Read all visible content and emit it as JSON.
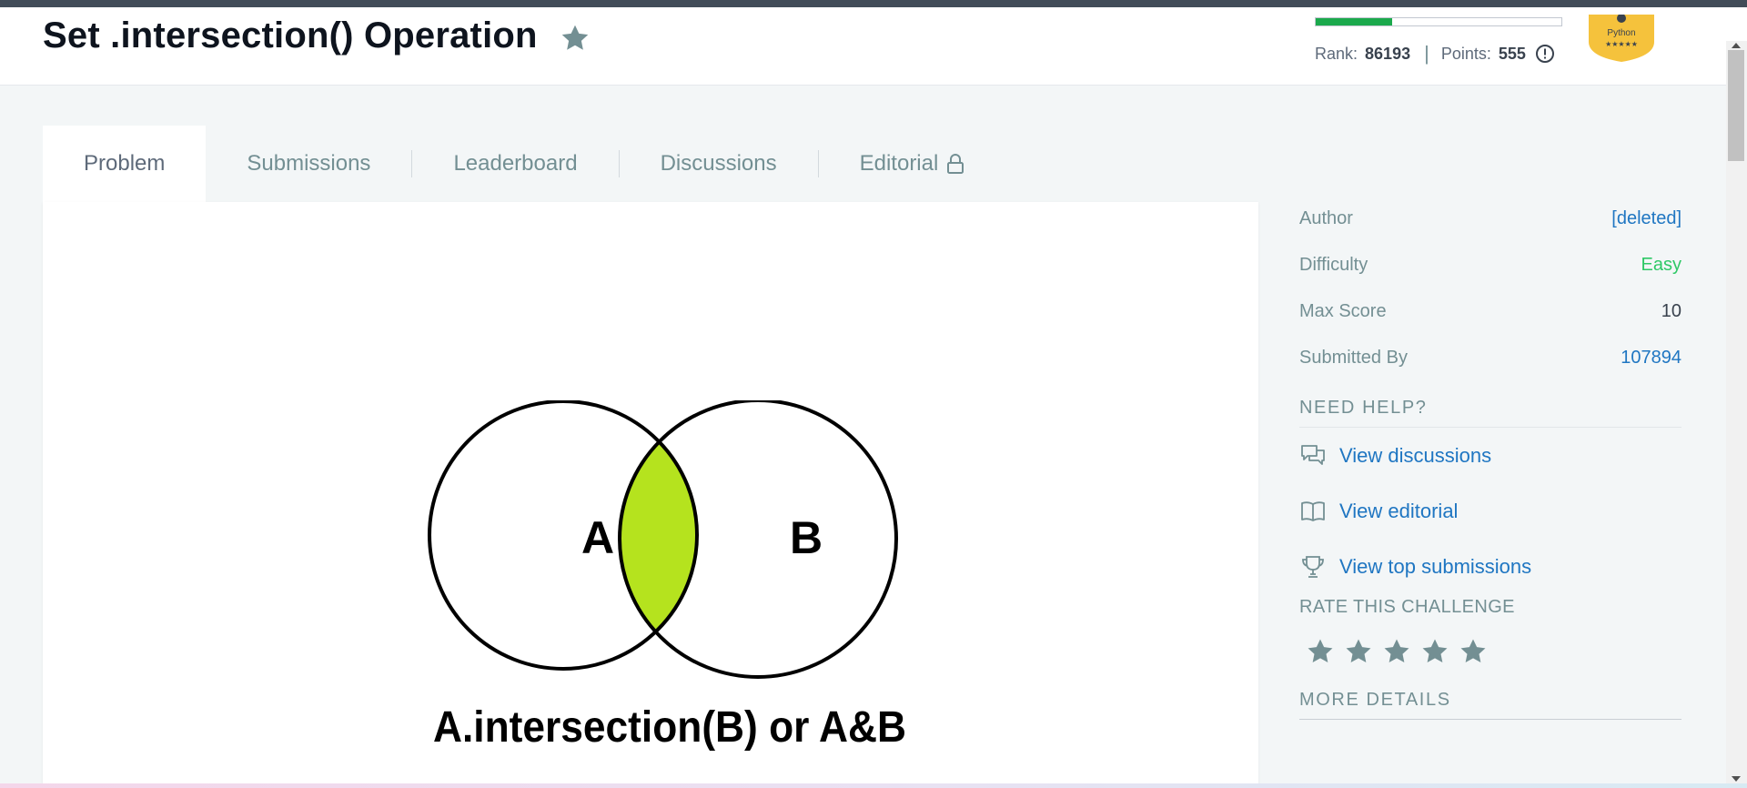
{
  "header": {
    "title": "Set .intersection() Operation",
    "progress_fraction": 0.31,
    "rank_label": "Rank:",
    "rank_value": "86193",
    "separator": "|",
    "points_label": "Points:",
    "points_value": "555",
    "badge": {
      "text": "Python",
      "stars": "★★★★★",
      "color": "#f5c23c"
    }
  },
  "tabs": [
    {
      "label": "Problem",
      "active": true
    },
    {
      "label": "Submissions",
      "active": false
    },
    {
      "label": "Leaderboard",
      "active": false
    },
    {
      "label": "Discussions",
      "active": false
    },
    {
      "label": "Editorial",
      "active": false,
      "icon": "lock-icon"
    }
  ],
  "problem": {
    "venn": {
      "left_label": "A",
      "right_label": "B",
      "caption": "A.intersection(B) or A&B",
      "highlight_color": "#b5e31e"
    }
  },
  "sidebar": {
    "meta": [
      {
        "label": "Author",
        "value": "[deleted]",
        "style": "link"
      },
      {
        "label": "Difficulty",
        "value": "Easy",
        "style": "easy"
      },
      {
        "label": "Max Score",
        "value": "10",
        "style": "plain"
      },
      {
        "label": "Submitted By",
        "value": "107894",
        "style": "link"
      }
    ],
    "need_help": {
      "heading": "NEED HELP?",
      "items": [
        {
          "label": "View discussions",
          "icon": "discussion-icon"
        },
        {
          "label": "View editorial",
          "icon": "book-icon"
        },
        {
          "label": "View top submissions",
          "icon": "trophy-icon"
        }
      ]
    },
    "rate": {
      "heading": "RATE THIS CHALLENGE",
      "max_stars": 5,
      "rating": 0
    },
    "more_details": {
      "heading": "MORE DETAILS"
    }
  },
  "colors": {
    "accent_link": "#1f76c2",
    "easy_green": "#2ec866",
    "progress_green": "#1ba94c",
    "icon_gray": "#738f93"
  }
}
